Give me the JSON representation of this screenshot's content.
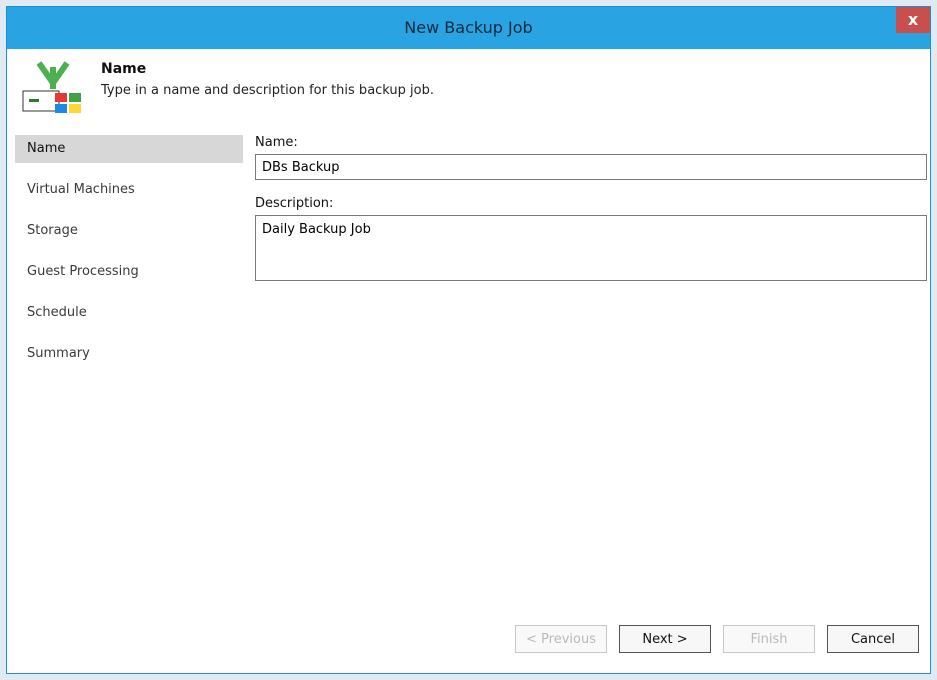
{
  "window": {
    "title": "New Backup Job",
    "close_glyph": "x"
  },
  "header": {
    "icon": "backup-arrow-icon",
    "title": "Name",
    "description": "Type in a name and description for this backup job."
  },
  "sidebar": {
    "items": [
      {
        "label": "Name",
        "selected": true
      },
      {
        "label": "Virtual Machines"
      },
      {
        "label": "Storage"
      },
      {
        "label": "Guest Processing"
      },
      {
        "label": "Schedule"
      },
      {
        "label": "Summary"
      }
    ]
  },
  "form": {
    "name_label": "Name:",
    "name_value": "DBs Backup",
    "description_label": "Description:",
    "description_value": "Daily Backup Job"
  },
  "buttons": {
    "previous": "< Previous",
    "next": "Next >",
    "finish": "Finish",
    "cancel": "Cancel"
  },
  "colors": {
    "titlebar": "#2aa3e3",
    "close": "#c94f4f",
    "selected_nav": "#d7d7d7"
  }
}
